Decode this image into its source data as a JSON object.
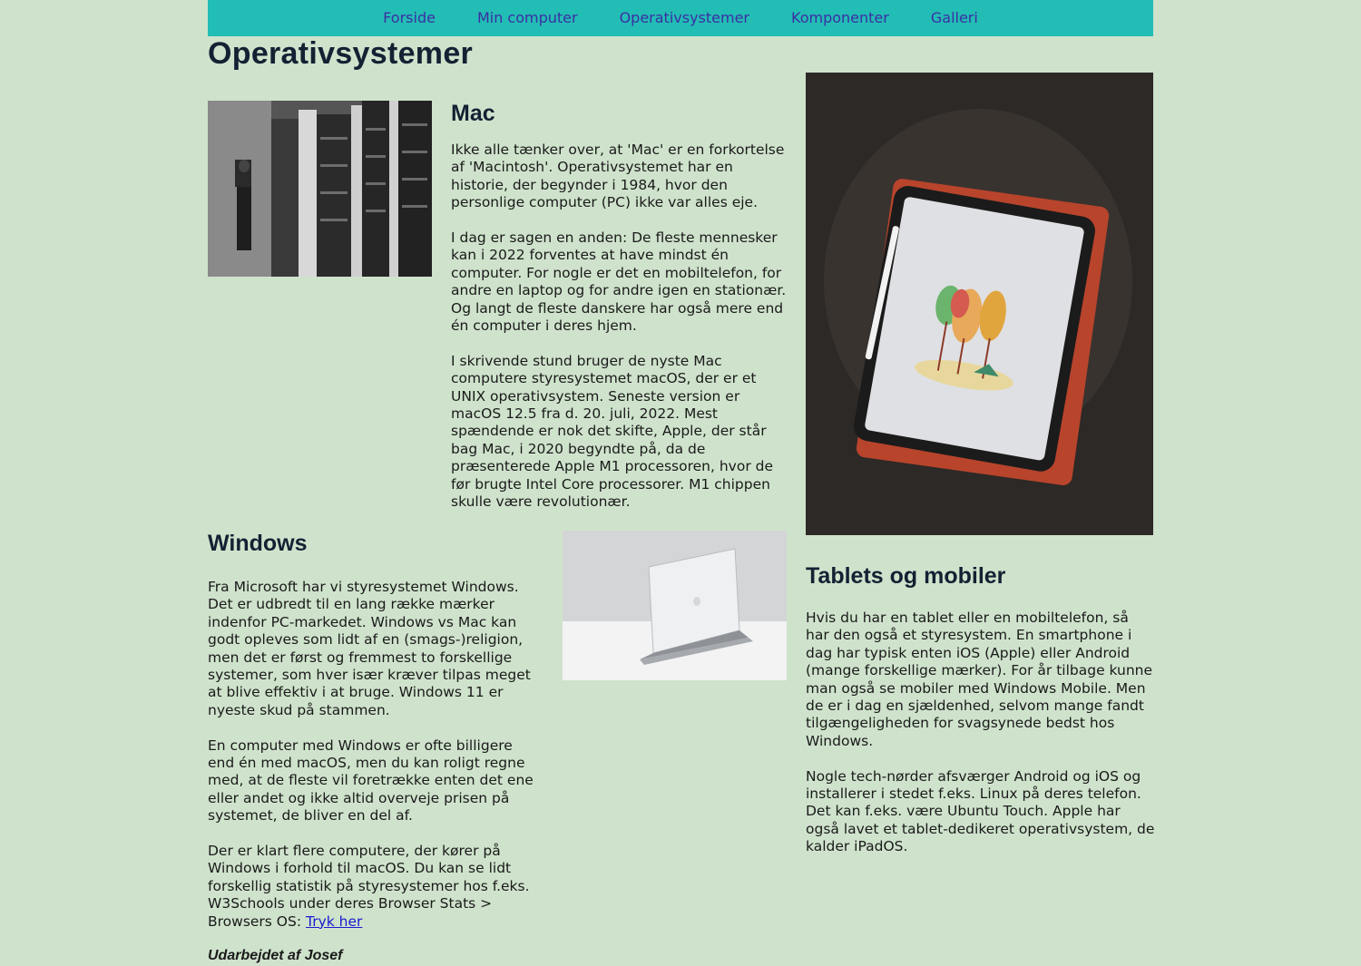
{
  "nav": {
    "items": [
      "Forside",
      "Min computer",
      "Operativsystemer",
      "Komponenter",
      "Galleri"
    ]
  },
  "page_title": "Operativsystemer",
  "mac": {
    "heading": "Mac",
    "paragraphs": [
      "Ikke alle tænker over, at 'Mac' er en forkortelse af 'Macintosh'. Operativsystemet har en historie, der begynder i 1984, hvor den personlige computer (PC) ikke var alles eje.",
      "I dag er sagen en anden: De fleste mennesker kan i 2022 forventes at have mindst én computer. For nogle er det en mobiltelefon, for andre en laptop og for andre igen en stationær. Og langt de fleste danskere har også mere end én computer i deres hjem.",
      "I skrivende stund bruger de nyste Mac computere styresystemet macOS, der er et UNIX operativsystem. Seneste version er macOS 12.5 fra d. 20. juli, 2022. Mest spændende er nok det skifte, Apple, der står bag Mac, i 2020 begyndte på, da de præsenterede Apple M1 processoren, hvor de før brugte Intel Core processorer. M1 chippen skulle være revolutionær."
    ]
  },
  "windows": {
    "heading": "Windows",
    "paragraphs": [
      "Fra Microsoft har vi styresystemet Windows. Det er udbredt til en lang række mærker indenfor PC-markedet. Windows vs Mac kan godt opleves som lidt af en (smags-)religion, men det er først og fremmest to forskellige systemer, som hver især kræver tilpas meget at blive effektiv i at bruge. Windows 11 er nyeste skud på stammen.",
      "En computer med Windows er ofte billigere end én med macOS, men du kan roligt regne med, at de fleste vil foretrække enten det ene eller andet og ikke altid overveje prisen på systemet, de bliver en del af.",
      "Der er klart flere computere, der kører på Windows i forhold til macOS. Du kan se lidt forskellig statistik på styresystemer hos f.eks. W3Schools under deres Browser Stats > Browsers OS:"
    ],
    "link_text": "Tryk her"
  },
  "tablets": {
    "heading": "Tablets og mobiler",
    "paragraphs": [
      "Hvis du har en tablet eller en mobiltelefon, så har den også et styresystem. En smartphone i dag har typisk enten iOS (Apple) eller Android (mange forskellige mærker). For år tilbage kunne man også se mobiler med Windows Mobile. Men de er i dag en sjældenhed, selvom mange fandt tilgængeligheden for svagsynede bedst hos Windows.",
      "Nogle tech-nørder afsværger Android og iOS og installerer i stedet f.eks. Linux på deres telefon. Det kan f.eks. være Ubuntu Touch. Apple har også lavet et tablet-dedikeret operativsystem, de kalder iPadOS."
    ]
  },
  "credit": "Udarbejdet af Josef",
  "colors": {
    "background": "#cfe3cc",
    "nav_bg": "#22bdb5",
    "nav_link": "#3b2fa3",
    "heading": "#152033",
    "link": "#1a1acc"
  }
}
